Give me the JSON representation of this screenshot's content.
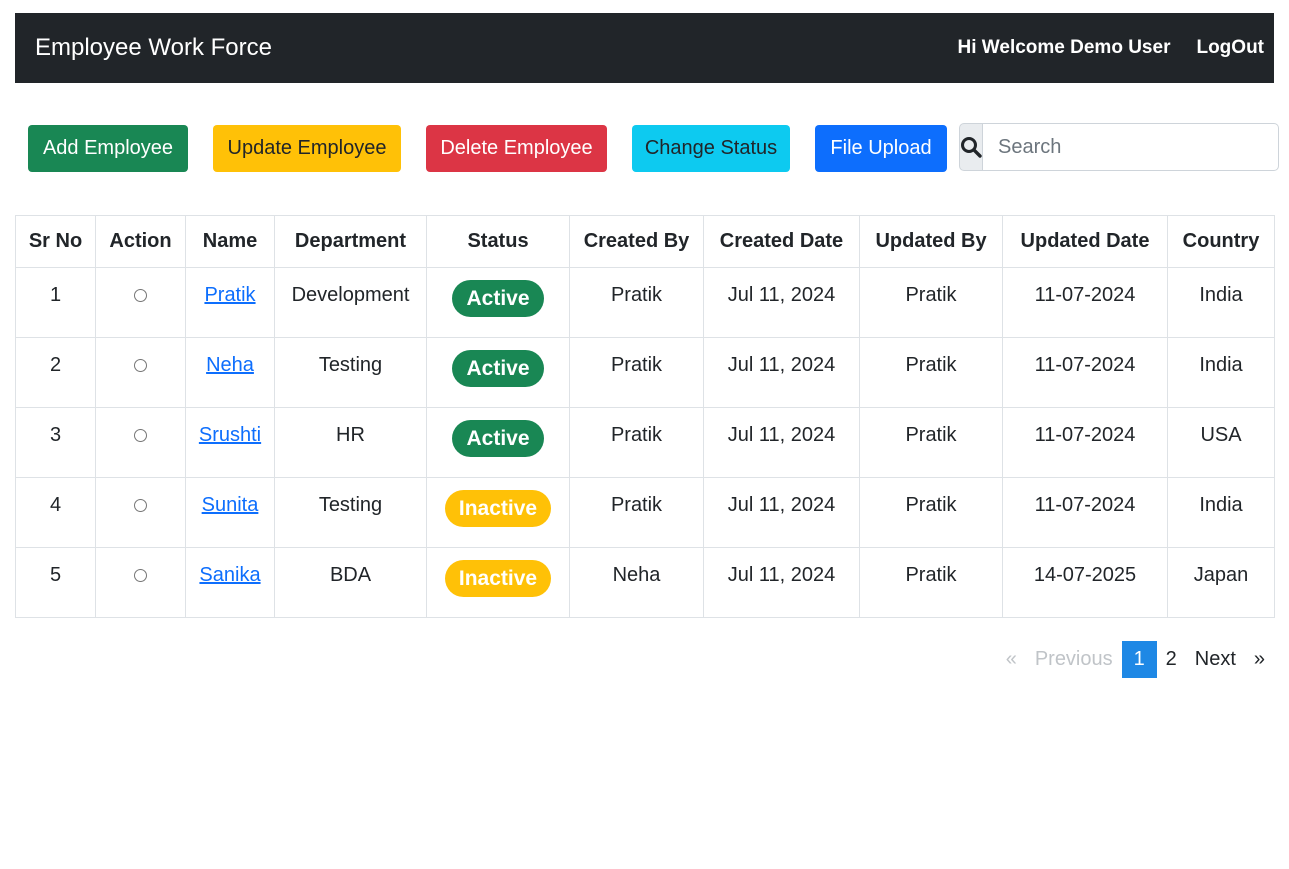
{
  "navbar": {
    "brand": "Employee Work Force",
    "welcome": "Hi Welcome Demo User",
    "logout": "LogOut",
    "background": "#212529"
  },
  "toolbar": {
    "add_label": "Add Employee",
    "update_label": "Update Employee",
    "delete_label": "Delete Employee",
    "status_label": "Change Status",
    "upload_label": "File Upload",
    "search_icon": "search-icon",
    "search_placeholder": "Search",
    "search_value": ""
  },
  "colors": {
    "success": "#198754",
    "warning": "#ffc107",
    "danger": "#dc3545",
    "info": "#0dcaf0",
    "primary": "#0d6efd",
    "link": "#0d6efd",
    "page_active": "#1e88e5"
  },
  "table": {
    "headers": [
      "Sr No",
      "Action",
      "Name",
      "Department",
      "Status",
      "Created By",
      "Created Date",
      "Updated By",
      "Updated Date",
      "Country"
    ],
    "rows": [
      {
        "sr": "1",
        "name": "Pratik",
        "department": "Development",
        "status": "Active",
        "status_kind": "active",
        "created_by": "Pratik",
        "created_date": "Jul 11, 2024",
        "updated_by": "Pratik",
        "updated_date": "11-07-2024",
        "country": "India"
      },
      {
        "sr": "2",
        "name": "Neha",
        "department": "Testing",
        "status": "Active",
        "status_kind": "active",
        "created_by": "Pratik",
        "created_date": "Jul 11, 2024",
        "updated_by": "Pratik",
        "updated_date": "11-07-2024",
        "country": "India"
      },
      {
        "sr": "3",
        "name": "Srushti",
        "department": "HR",
        "status": "Active",
        "status_kind": "active",
        "created_by": "Pratik",
        "created_date": "Jul 11, 2024",
        "updated_by": "Pratik",
        "updated_date": "11-07-2024",
        "country": "USA"
      },
      {
        "sr": "4",
        "name": "Sunita",
        "department": "Testing",
        "status": "Inactive",
        "status_kind": "inactive",
        "created_by": "Pratik",
        "created_date": "Jul 11, 2024",
        "updated_by": "Pratik",
        "updated_date": "11-07-2024",
        "country": "India"
      },
      {
        "sr": "5",
        "name": "Sanika",
        "department": "BDA",
        "status": "Inactive",
        "status_kind": "inactive",
        "created_by": "Neha",
        "created_date": "Jul 11, 2024",
        "updated_by": "Pratik",
        "updated_date": "14-07-2025",
        "country": "Japan"
      }
    ]
  },
  "pagination": {
    "first": "«",
    "previous": "Previous",
    "pages": [
      "1",
      "2"
    ],
    "active_page": "1",
    "next": "Next",
    "last": "»"
  }
}
